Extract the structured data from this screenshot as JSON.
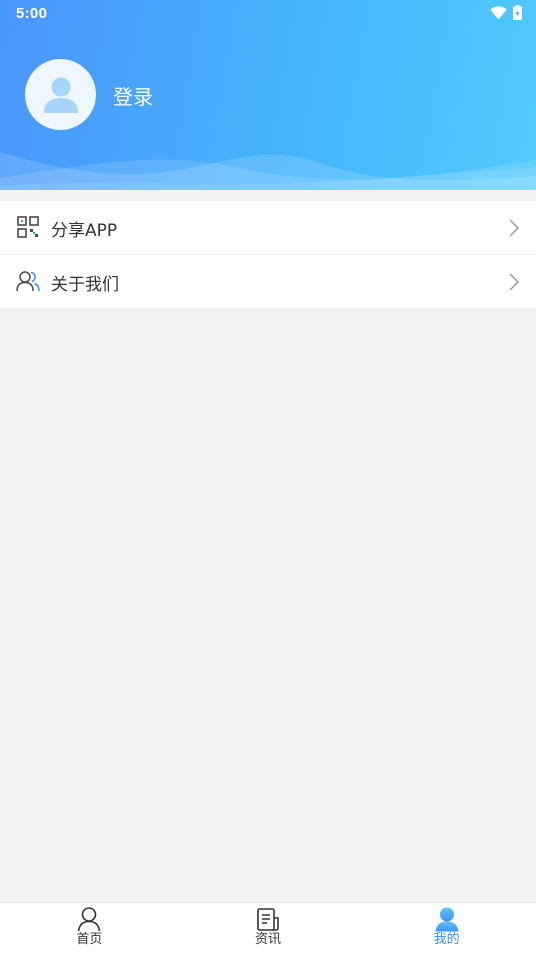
{
  "status_bar": {
    "time": "5:00",
    "icons": [
      "wifi-icon",
      "battery-charging-icon"
    ]
  },
  "header": {
    "avatar_icon": "user-avatar-icon",
    "login_label": "登录",
    "gradient_colors": [
      "#4a96fb",
      "#52cbff"
    ]
  },
  "menu": {
    "items": [
      {
        "label": "分享APP",
        "icon": "qr-code-icon"
      },
      {
        "label": "关于我们",
        "icon": "users-icon"
      }
    ]
  },
  "tabbar": {
    "active_color": "#3a8ef6",
    "tabs": [
      {
        "label": "首页",
        "icon": "person-outline-icon",
        "active": false
      },
      {
        "label": "资讯",
        "icon": "news-icon",
        "active": false
      },
      {
        "label": "我的",
        "icon": "person-filled-icon",
        "active": true
      }
    ]
  }
}
